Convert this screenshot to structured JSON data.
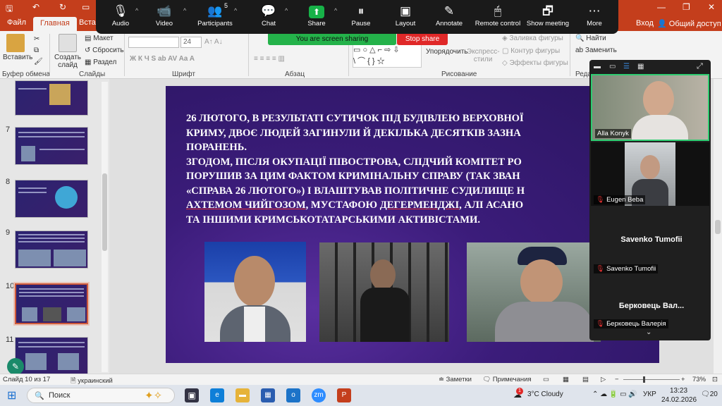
{
  "titlebar": {
    "left_right": "Вход",
    "share": "Общий доступ"
  },
  "tabs": [
    "Файл",
    "Главная",
    "Вставка"
  ],
  "ribbon": {
    "paste": "Вставить",
    "create_slide": "Создать слайд",
    "layout": "Макет",
    "reset": "Сбросить",
    "section": "Раздел",
    "font_size": "24",
    "arrange": "Упорядочить",
    "express_styles": "Экспресс-стили",
    "shape_fill": "Заливка фигуры",
    "shape_outline": "Контур фигуры",
    "shape_effects": "Эффекты фигуры",
    "find": "Найти",
    "replace": "Заменить",
    "groups": {
      "clipboard": "Буфер обмена",
      "slides": "Слайды",
      "font": "Шрифт",
      "paragraph": "Абзац",
      "drawing": "Рисование",
      "editing": "Реда"
    }
  },
  "zoom_toolbar": {
    "buttons": [
      {
        "label": "Audio",
        "icon": "microphone-icon",
        "glyph": "🎙"
      },
      {
        "label": "Video",
        "icon": "camera-icon",
        "glyph": "📹"
      },
      {
        "label": "Participants",
        "icon": "people-icon",
        "glyph": "👥"
      },
      {
        "label": "Chat",
        "icon": "chat-icon",
        "glyph": "💬"
      },
      {
        "label": "Share",
        "icon": "share-icon",
        "glyph": "⬆"
      },
      {
        "label": "Pause",
        "icon": "pause-icon",
        "glyph": "⏸"
      },
      {
        "label": "Layout",
        "icon": "layout-icon",
        "glyph": "▣"
      },
      {
        "label": "Annotate",
        "icon": "pen-icon",
        "glyph": "✎"
      },
      {
        "label": "Remote control",
        "icon": "mouse-icon",
        "glyph": "🖱"
      },
      {
        "label": "Show meeting",
        "icon": "show-meeting-icon",
        "glyph": "🗗"
      },
      {
        "label": "More",
        "icon": "more-icon",
        "glyph": "⋯"
      }
    ],
    "participants_count": "5",
    "sharing_status": "You are screen sharing",
    "stop_share": "Stop share"
  },
  "thumbnails": [
    "7",
    "8",
    "9",
    "10",
    "11"
  ],
  "slide": {
    "lines": [
      "26 ЛЮТОГО, В РЕЗУЛЬТАТІ СУТИЧОК ПІД БУДІВЛЕЮ ВЕРХОВНОЇ",
      "КРИМУ, ДВОЄ ЛЮДЕЙ ЗАГИНУЛИ Й ДЕКІЛЬКА ДЕСЯТКІВ ЗАЗНА",
      "ПОРАНЕНЬ.",
      "ЗГОДОМ, ПІСЛЯ ОКУПАЦІЇ ПІВОСТРОВА, СЛІДЧИЙ КОМІТЕТ РО",
      "ПОРУШИВ ЗА ЦИМ ФАКТОМ КРИМІНАЛЬНУ СПРАВУ (ТАК ЗВАН",
      "«СПРАВА 26 ЛЮТОГО») І ВЛАШТУВАВ ПОЛІТИЧНЕ СУДИЛИЩЕ Н"
    ],
    "line7_a": "АХТЕМОМ ЧИЙГОЗОМ",
    "line7_b": ", МУСТАФОЮ ",
    "line7_c": "ДЕГЕРМЕНДЖІ",
    "line7_d": ", АЛІ АСАНО",
    "line8": "ТА ІНШИМИ КРИМСЬКОТАТАРСЬКИМИ АКТИВІСТАМИ."
  },
  "gallery": {
    "participants": [
      {
        "name": "Alla Konyk"
      },
      {
        "name": "Eugen Beba"
      },
      {
        "name": "Savenko Tumofii",
        "big": "Savenko Tumofii"
      },
      {
        "name": "Берковець Валерія",
        "big": "Берковець Вал..."
      }
    ]
  },
  "statusbar": {
    "slide": "Слайд 10 из 17",
    "language": "украинский",
    "notes": "Заметки",
    "comments": "Примечания",
    "zoom": "73%"
  },
  "taskbar": {
    "search": "Поиск",
    "weather": "3°C  Cloudy",
    "weather_badge": "1",
    "lang": "УКР",
    "time": "13:23",
    "date": "24.02.2026",
    "notifications": "20"
  },
  "colors": {
    "accent": "#c43e1c",
    "zoom_green": "#24b24a",
    "stop_red": "#e02828",
    "slide_bg": "#3b1c7a"
  }
}
